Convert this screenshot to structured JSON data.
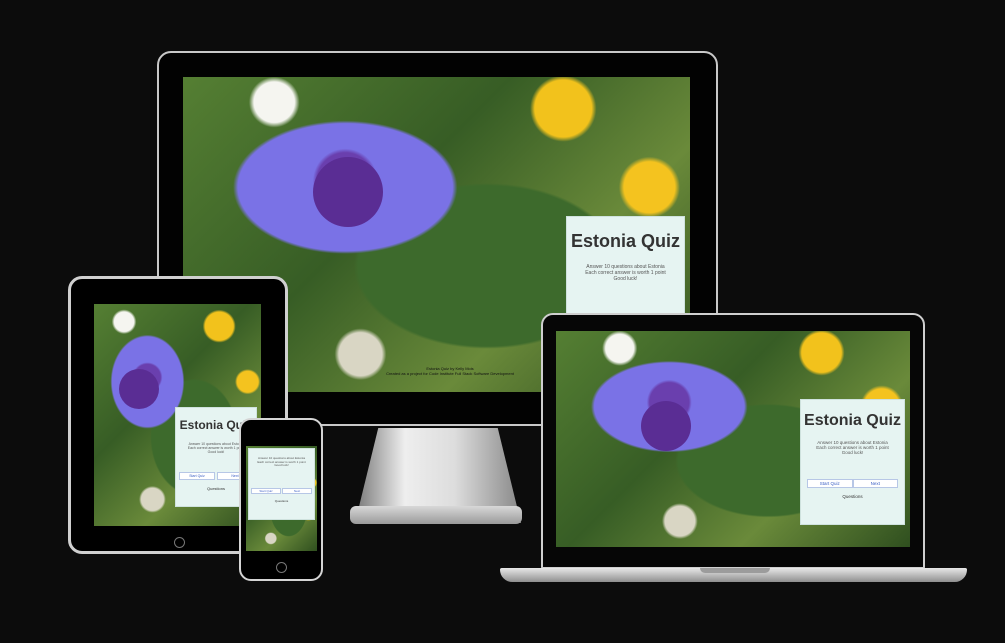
{
  "quiz": {
    "title": "Estonia Quiz",
    "rules": [
      "Answer 10 questions about Estonia",
      "Each correct answer is worth 1 point",
      "Good luck!"
    ],
    "start_button": "Start Quiz",
    "next_button": "Next",
    "score_label": "Questions"
  },
  "footer": {
    "line1": "Estonia Quiz by Kelly Mois",
    "line2": "Created as a project for Code Institute Full Stack Software Development"
  },
  "colors": {
    "background": "#0c0c0c",
    "card": "#e6f4f2",
    "button_text": "#3b5fc4"
  }
}
